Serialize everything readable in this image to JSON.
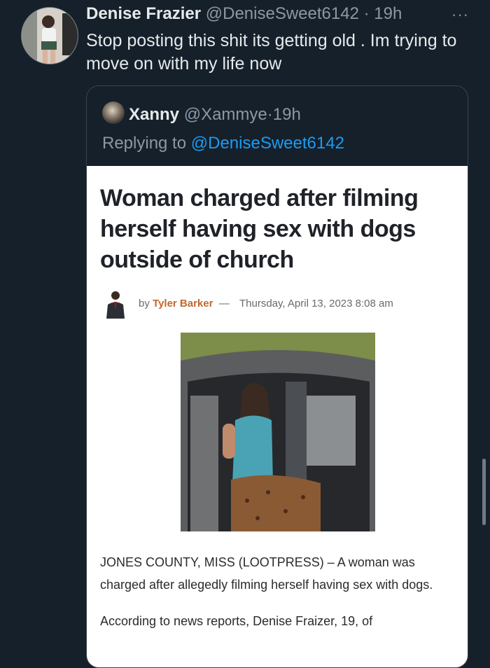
{
  "tweet": {
    "name": "Denise Frazier",
    "handle": "@DeniseSweet6142",
    "separator": "·",
    "time": "19h",
    "more": "···",
    "text": "Stop posting this shit its getting old . Im trying to move on with my life now"
  },
  "quote": {
    "name": "Xanny",
    "handle": "@Xammye",
    "separator": "·",
    "time": "19h",
    "replying_label": "Replying to",
    "replying_handle": "@DeniseSweet6142"
  },
  "article": {
    "headline": "Woman charged after filming herself having sex with dogs outside of church",
    "by_label": "by",
    "author": "Tyler Barker",
    "dash": "—",
    "date": "Thursday, April 13, 2023 8:08 am",
    "paragraphs": [
      "JONES COUNTY, MISS (LOOTPRESS) – A woman was charged after allegedly filming herself having sex with dogs.",
      "According to news reports, Denise Fraizer, 19, of"
    ]
  },
  "icons": {
    "more": "more-horizontal-icon"
  },
  "colors": {
    "background": "#15202b",
    "primary_text": "#e7e9ea",
    "secondary_text": "#8b98a5",
    "link": "#1d9bf0",
    "author_accent": "#c4662d"
  }
}
